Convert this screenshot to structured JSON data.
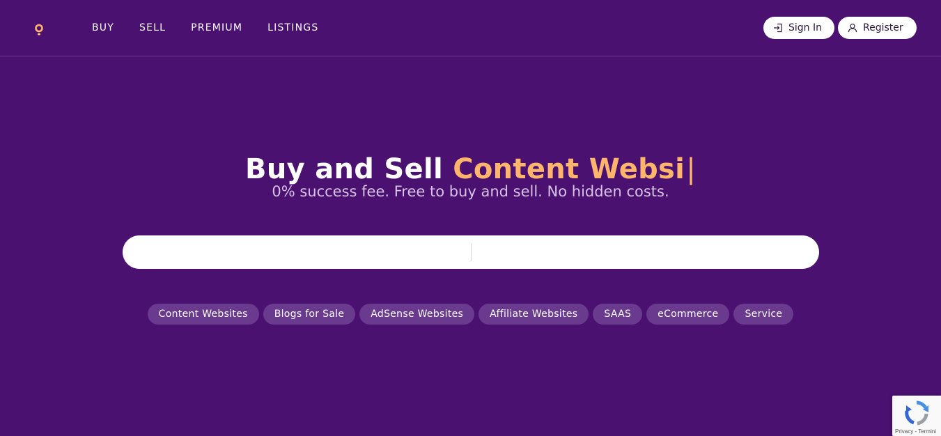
{
  "header": {
    "nav": [
      {
        "label": "BUY"
      },
      {
        "label": "SELL"
      },
      {
        "label": "PREMIUM"
      },
      {
        "label": "LISTINGS"
      }
    ],
    "signin_label": "Sign In",
    "register_label": "Register"
  },
  "hero": {
    "headline_plain": "Buy and Sell",
    "headline_accent": "Content Websi",
    "cursor": "|",
    "subheadline": "0% success fee. Free to buy and sell. No hidden costs."
  },
  "search": {
    "left_value": "",
    "left_placeholder": "",
    "right_value": "",
    "right_placeholder": ""
  },
  "categories": [
    {
      "label": "Content Websites"
    },
    {
      "label": "Blogs for Sale"
    },
    {
      "label": "AdSense Websites"
    },
    {
      "label": "Affiliate Websites"
    },
    {
      "label": "SAAS"
    },
    {
      "label": "eCommerce"
    },
    {
      "label": "Service"
    }
  ],
  "recaptcha": {
    "text": "Privacy - Termini"
  },
  "colors": {
    "background": "#4a1170",
    "accent": "#ffb56b",
    "chip": "#6a3a8e",
    "subtext": "#d6c3e6"
  },
  "icons": {
    "logo": "map-pin-icon",
    "signin": "sign-in-icon",
    "register": "user-icon",
    "recaptcha": "recaptcha-icon"
  }
}
